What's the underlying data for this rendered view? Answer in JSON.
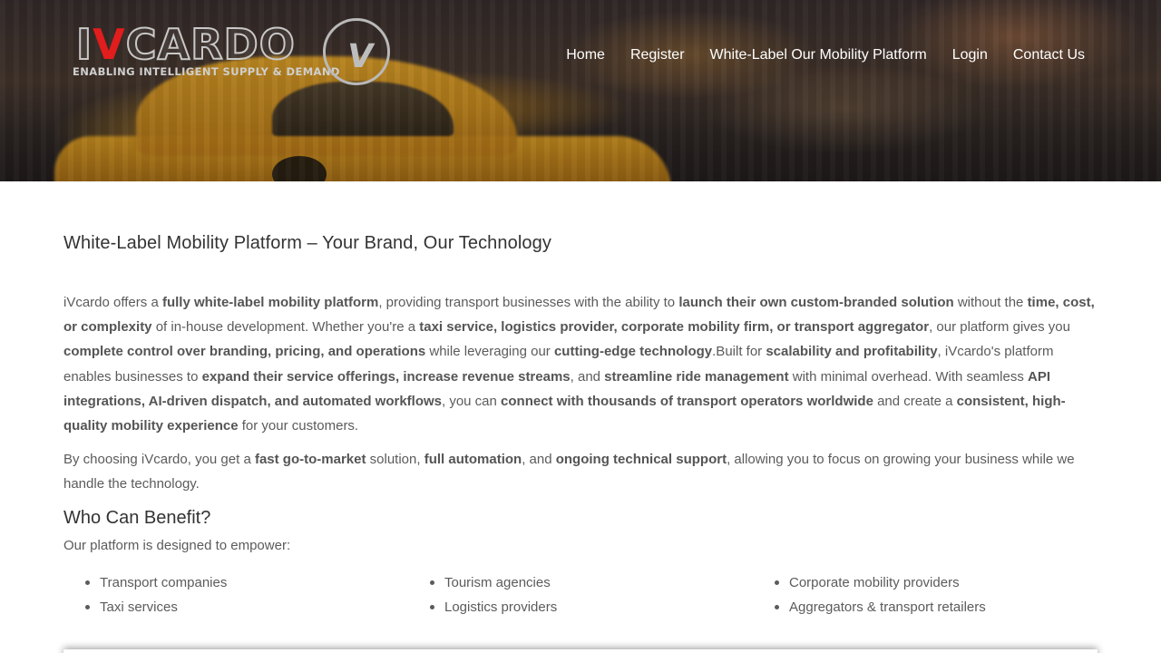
{
  "brand": {
    "logo_prefix": "I",
    "logo_accent": "V",
    "logo_suffix": "CARDO",
    "tagline": "ENABLING INTELLIGENT SUPPLY & DEMAND",
    "emblem_letter": "V",
    "accent_color": "#e11d1d"
  },
  "nav": {
    "items": [
      {
        "label": "Home"
      },
      {
        "label": "Register"
      },
      {
        "label": "White-Label Our Mobility Platform"
      },
      {
        "label": "Login"
      },
      {
        "label": "Contact Us"
      }
    ]
  },
  "main": {
    "title": "White-Label Mobility Platform – Your Brand, Our Technology",
    "p1": [
      "iVcardo offers a ",
      "fully white-label mobility platform",
      ", providing transport businesses with the ability to ",
      "launch their own custom-branded solution",
      " without the ",
      "time, cost, or complexity",
      " of in-house development. Whether you're a ",
      "taxi service, logistics provider, corporate mobility firm, or transport aggregator",
      ", our platform gives you ",
      "complete control over branding, pricing, and operations",
      " while leveraging our ",
      "cutting-edge technology",
      ".Built for ",
      "scalability and profitability",
      ", iVcardo's platform enables businesses to ",
      "expand their service offerings, increase revenue streams",
      ", and ",
      "streamline ride management",
      " with minimal overhead. With seamless ",
      "API integrations, AI-driven dispatch, and automated workflows",
      ", you can ",
      "connect with thousands of transport operators worldwide",
      " and create a ",
      "consistent, high-quality mobility experience",
      " for your customers."
    ],
    "p2": [
      "By choosing iVcardo, you get a ",
      "fast go-to-market",
      " solution, ",
      "full automation",
      ", and ",
      "ongoing technical support",
      ", allowing you to focus on growing your business while we handle the technology."
    ],
    "benefit_title": "Who Can Benefit?",
    "benefit_intro": "Our platform is designed to empower:",
    "benefit_columns": [
      [
        "Transport companies",
        "Taxi services"
      ],
      [
        "Tourism agencies",
        "Logistics providers"
      ],
      [
        "Corporate mobility providers",
        "Aggregators & transport retailers"
      ]
    ]
  }
}
